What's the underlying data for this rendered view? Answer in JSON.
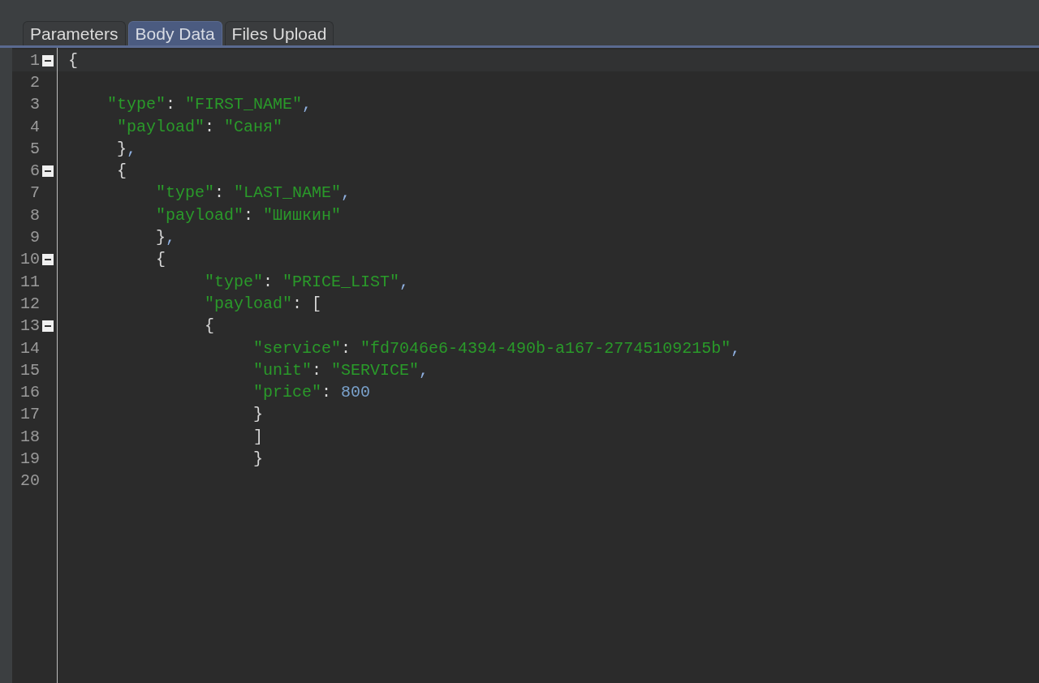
{
  "tabs": [
    {
      "label": "Parameters",
      "selected": false
    },
    {
      "label": "Body Data",
      "selected": true
    },
    {
      "label": "Files Upload",
      "selected": false
    }
  ],
  "editor": {
    "lines": [
      {
        "number": "1",
        "fold": true,
        "current": true,
        "tokens": [
          {
            "kind": "punct",
            "text": "{"
          }
        ]
      },
      {
        "number": "2"
      },
      {
        "number": "3",
        "tokens": [
          {
            "kind": "string",
            "text": "    \"type\""
          },
          {
            "kind": "punct",
            "text": ": "
          },
          {
            "kind": "string",
            "text": "\"FIRST_NAME\""
          },
          {
            "kind": "comma",
            "text": ","
          }
        ]
      },
      {
        "number": "4",
        "tokens": [
          {
            "kind": "string",
            "text": "     \"payload\""
          },
          {
            "kind": "punct",
            "text": ": "
          },
          {
            "kind": "string",
            "text": "\"Саня\""
          }
        ]
      },
      {
        "number": "5",
        "tokens": [
          {
            "kind": "punct",
            "text": "     }"
          },
          {
            "kind": "comma",
            "text": ","
          }
        ]
      },
      {
        "number": "6",
        "fold": true,
        "tokens": [
          {
            "kind": "punct",
            "text": "     {"
          }
        ]
      },
      {
        "number": "7",
        "tokens": [
          {
            "kind": "string",
            "text": "         \"type\""
          },
          {
            "kind": "punct",
            "text": ": "
          },
          {
            "kind": "string",
            "text": "\"LAST_NAME\""
          },
          {
            "kind": "comma",
            "text": ","
          }
        ]
      },
      {
        "number": "8",
        "tokens": [
          {
            "kind": "string",
            "text": "         \"payload\""
          },
          {
            "kind": "punct",
            "text": ": "
          },
          {
            "kind": "string",
            "text": "\"Шишкин\""
          }
        ]
      },
      {
        "number": "9",
        "tokens": [
          {
            "kind": "punct",
            "text": "         }"
          },
          {
            "kind": "comma",
            "text": ","
          }
        ]
      },
      {
        "number": "10",
        "fold": true,
        "tokens": [
          {
            "kind": "punct",
            "text": "         {"
          }
        ]
      },
      {
        "number": "11",
        "tokens": [
          {
            "kind": "string",
            "text": "              \"type\""
          },
          {
            "kind": "punct",
            "text": ": "
          },
          {
            "kind": "string",
            "text": "\"PRICE_LIST\""
          },
          {
            "kind": "comma",
            "text": ","
          }
        ]
      },
      {
        "number": "12",
        "tokens": [
          {
            "kind": "string",
            "text": "              \"payload\""
          },
          {
            "kind": "punct",
            "text": ": ["
          }
        ]
      },
      {
        "number": "13",
        "fold": true,
        "tokens": [
          {
            "kind": "punct",
            "text": "              {"
          }
        ]
      },
      {
        "number": "14",
        "tokens": [
          {
            "kind": "string",
            "text": "                   \"service\""
          },
          {
            "kind": "punct",
            "text": ": "
          },
          {
            "kind": "string",
            "text": "\"fd7046e6-4394-490b-a167-27745109215b\""
          },
          {
            "kind": "comma",
            "text": ","
          }
        ]
      },
      {
        "number": "15",
        "tokens": [
          {
            "kind": "string",
            "text": "                   \"unit\""
          },
          {
            "kind": "punct",
            "text": ": "
          },
          {
            "kind": "string",
            "text": "\"SERVICE\""
          },
          {
            "kind": "comma",
            "text": ","
          }
        ]
      },
      {
        "number": "16",
        "tokens": [
          {
            "kind": "string",
            "text": "                   \"price\""
          },
          {
            "kind": "punct",
            "text": ": "
          },
          {
            "kind": "number",
            "text": "800"
          }
        ]
      },
      {
        "number": "17",
        "tokens": [
          {
            "kind": "punct",
            "text": "                   }"
          }
        ]
      },
      {
        "number": "18",
        "tokens": [
          {
            "kind": "punct",
            "text": "                   ]"
          }
        ]
      },
      {
        "number": "19",
        "tokens": [
          {
            "kind": "punct",
            "text": "                   }"
          }
        ]
      },
      {
        "number": "20"
      }
    ]
  }
}
